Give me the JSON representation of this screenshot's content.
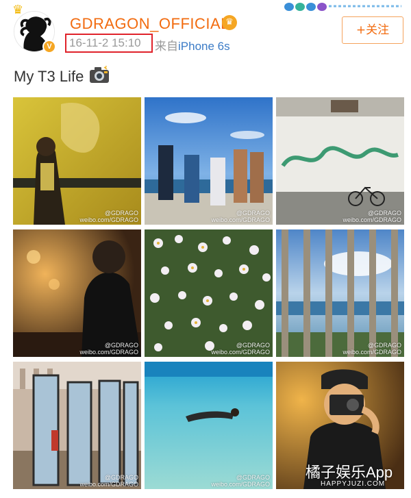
{
  "post": {
    "username": "GDRAGON_OFFICIAL",
    "timestamp": "16-11-2 15:10",
    "source_prefix": "来自",
    "source_app": "iPhone 6s",
    "text": "My T3 Life",
    "follow_label": "+关注"
  },
  "photos": {
    "watermark_handle": "@GDRAGO",
    "watermark_url": "weibo.com/GDRAGO"
  },
  "site_watermark": {
    "name": "橘子娱乐App",
    "url": "HAPPYJUZI.COM"
  },
  "colors": {
    "username": "#f26b0f",
    "link": "#3b7bc6",
    "highlight_box": "#e0222a",
    "follow_border": "#f5a35c"
  },
  "icons": {
    "avatar_crown": "crown-icon",
    "verified": "verified-icon",
    "vip": "crown-badge-icon",
    "post_emoji": "camera-icon"
  }
}
